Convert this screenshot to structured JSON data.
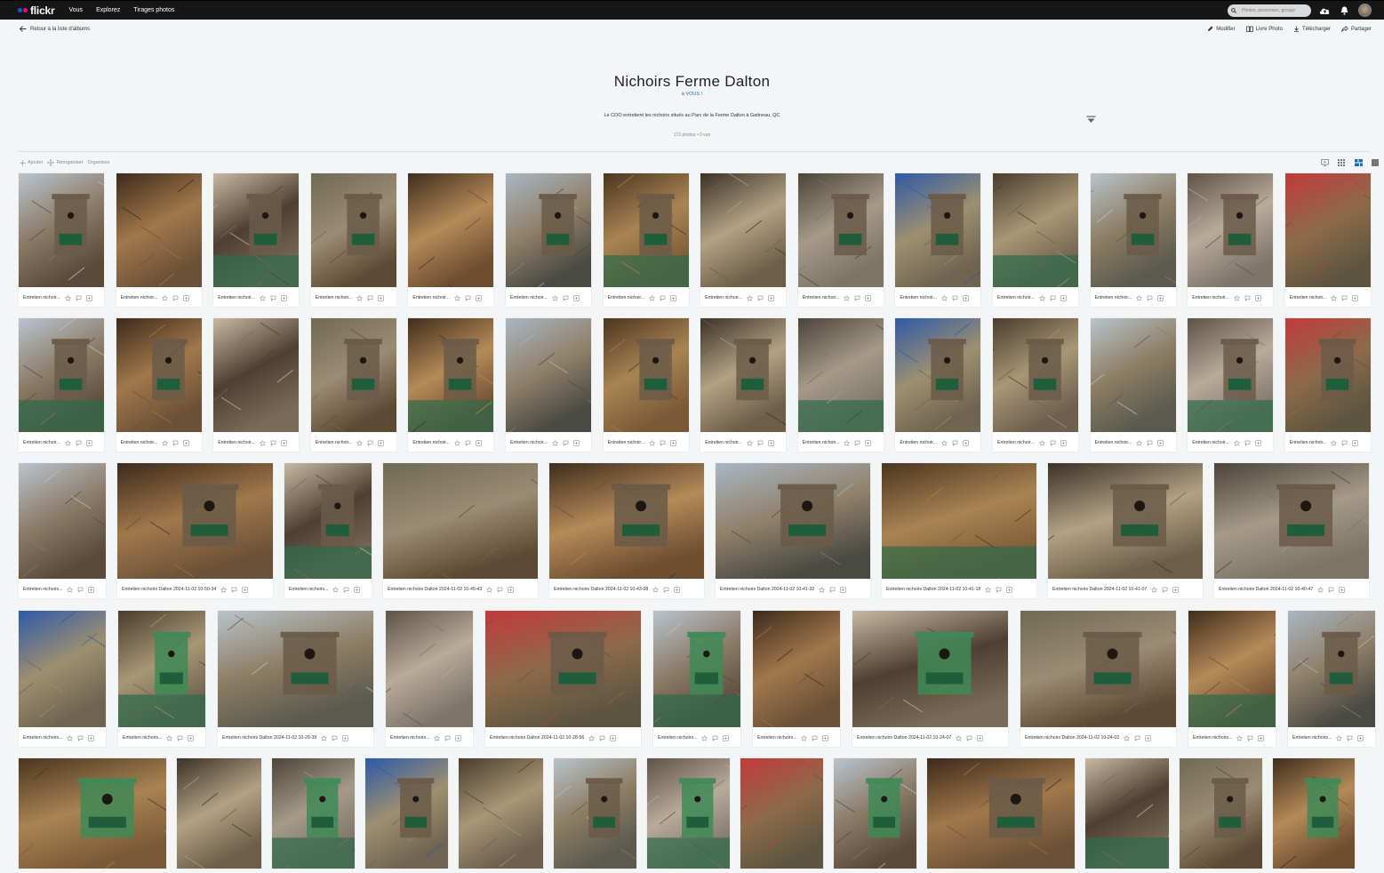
{
  "nav": {
    "logo": "flickr",
    "logo_colors": [
      "#0063dc",
      "#ff0084"
    ],
    "links": [
      "Vous",
      "Explorez",
      "Tirages photos"
    ],
    "search_placeholder": "Photos, personnes, groupe",
    "icons": [
      "cloud-upload-icon",
      "bell-icon",
      "avatar"
    ]
  },
  "subbar": {
    "back": "Retour à la liste d'albums",
    "actions": [
      {
        "label": "Modifier",
        "icon": "pencil-icon"
      },
      {
        "label": "Livre Photo",
        "icon": "book-icon"
      },
      {
        "label": "Télécharger",
        "icon": "download-icon"
      },
      {
        "label": "Partager",
        "icon": "share-icon"
      }
    ]
  },
  "album": {
    "title": "Nichoirs Ferme Dalton",
    "by_prefix": "à",
    "owner": "VOUS !",
    "description": "Le COO entretient les nichoirs situés au Parc de la Ferme Dalton à Gatineau, QC",
    "stats": "172 photos   •   0 vue"
  },
  "toolbar": {
    "add": "Ajouter",
    "reorder": "Réorganiser",
    "organize": "Organisez",
    "views": [
      "slideshow-icon",
      "grid-small-icon",
      "grid-justified-icon",
      "grid-large-icon"
    ],
    "active_view": 2
  },
  "photos": {
    "short_caption": "Entretien nichoir...",
    "short_caption_b": "Entretien nichoirs...",
    "row3_captions": [
      "Entretien nichoirs...",
      "Entretien nichoirs Dalton 2024-11-02 10-50-34",
      "Entretien nichoirs...",
      "Entretien nichoirs Dalton 2024-11-02 10-45-43",
      "Entretien nichoirs Dalton 2024-11-02 10-43-08",
      "Entretien nichoirs Dalton 2024-11-02 10-41-32",
      "Entretien nichoirs Dalton 2024-11-02 10-41-18",
      "Entretien nichoirs Dalton 2024-11-02 10-41-07",
      "Entretien nichoirs Dalton 2024-11-02 10-40-47"
    ],
    "row4_captions": [
      "Entretien nichoirs...",
      "Entretien nichoirs...",
      "Entretien nichoirs Dalton 2024-11-02 10-29-39",
      "Entretien nichoirs...",
      "Entretien nichoirs Dalton 2024-11-02 10-28-56",
      "Entretien nichoirs...",
      "Entretien nichoirs...",
      "Entretien nichoirs Dalton 2024-11-02 10-24-07",
      "Entretien nichoirs Dalton 2024-11-02 10-24-02",
      "Entretien nichoirs...",
      "Entretien nichoirs..."
    ],
    "tile_icons": [
      "star-icon",
      "comment-icon",
      "add-to-icon"
    ]
  }
}
